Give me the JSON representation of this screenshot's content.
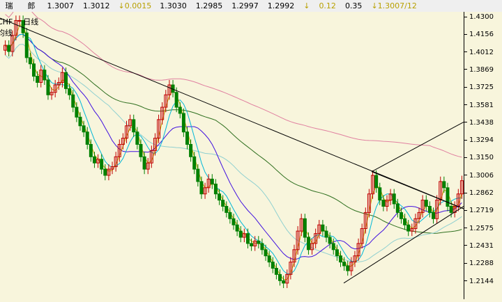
{
  "quote_bar": {
    "name": "瑞",
    "name2": "郎",
    "open": "1.3007",
    "high": "1.3012",
    "change": "0.0015",
    "last": "1.3030",
    "low1": "1.2985",
    "low2": "1.2997",
    "prev": "1.2992",
    "v1": "0.12",
    "v2": "0.35",
    "v3": "1.3007/12"
  },
  "labels": {
    "symbol": "CHF",
    "period": "日线",
    "extra": "均线"
  },
  "colors": {
    "up": "#c00000",
    "down": "#008000",
    "ma5": "#c8a800",
    "ma10": "#00b8d8",
    "ma20": "#4010e0",
    "ma60": "#90d0d0",
    "ma120": "#307020",
    "ma250": "#e080a0",
    "trend": "#000000"
  },
  "y_axis": {
    "ticks": [
      "1.4300",
      "1.4156",
      "1.4012",
      "1.3869",
      "1.3725",
      "1.3581",
      "1.3438",
      "1.3294",
      "1.3150",
      "1.3006",
      "1.2862",
      "1.2719",
      "1.2575",
      "1.2431",
      "1.2288",
      "1.2144"
    ]
  },
  "chart_data": {
    "type": "candlestick",
    "y_range": [
      1.205,
      1.437
    ],
    "series_close": [
      1.41,
      1.405,
      1.418,
      1.43,
      1.43,
      1.42,
      1.4,
      1.395,
      1.385,
      1.38,
      1.39,
      1.382,
      1.37,
      1.372,
      1.378,
      1.38,
      1.388,
      1.375,
      1.37,
      1.36,
      1.352,
      1.345,
      1.34,
      1.33,
      1.32,
      1.315,
      1.318,
      1.31,
      1.305,
      1.31,
      1.312,
      1.32,
      1.33,
      1.335,
      1.345,
      1.35,
      1.34,
      1.33,
      1.32,
      1.31,
      1.315,
      1.325,
      1.335,
      1.35,
      1.36,
      1.37,
      1.378,
      1.372,
      1.36,
      1.355,
      1.34,
      1.33,
      1.32,
      1.31,
      1.3,
      1.29,
      1.295,
      1.302,
      1.298,
      1.29,
      1.285,
      1.28,
      1.275,
      1.27,
      1.265,
      1.26,
      1.255,
      1.258,
      1.25,
      1.248,
      1.252,
      1.25,
      1.245,
      1.24,
      1.235,
      1.23,
      1.225,
      1.22,
      1.218,
      1.225,
      1.235,
      1.245,
      1.26,
      1.27,
      1.255,
      1.245,
      1.25,
      1.258,
      1.265,
      1.26,
      1.255,
      1.25,
      1.245,
      1.24,
      1.235,
      1.232,
      1.228,
      1.235,
      1.24,
      1.25,
      1.262,
      1.275,
      1.29,
      1.305,
      1.295,
      1.285,
      1.28,
      1.285,
      1.29,
      1.282,
      1.275,
      1.27,
      1.265,
      1.26,
      1.262,
      1.27,
      1.275,
      1.285,
      1.28,
      1.275,
      1.27,
      1.285,
      1.3,
      1.295,
      1.28,
      1.275,
      1.28,
      1.29,
      1.3007
    ]
  }
}
